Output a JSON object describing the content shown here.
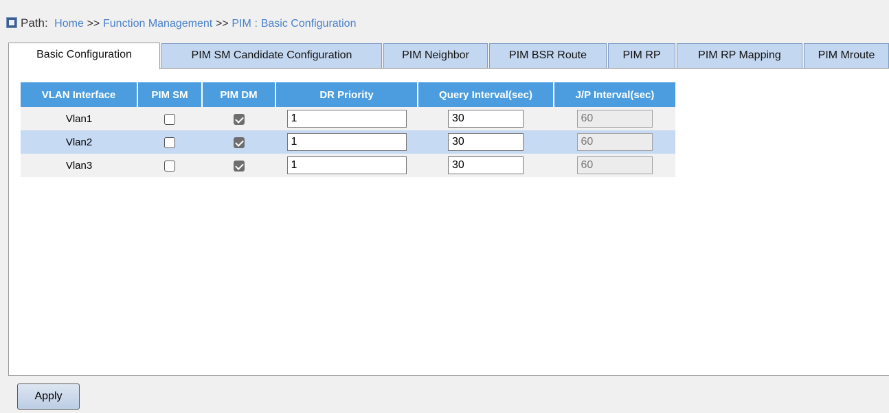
{
  "breadcrumb": {
    "label": "Path:",
    "home": "Home",
    "separator": ">>",
    "function_management": "Function Management",
    "pim": "PIM",
    "colon": ":",
    "current": "Basic Configuration"
  },
  "tabs": [
    {
      "label": "Basic Configuration",
      "active": true
    },
    {
      "label": "PIM SM Candidate Configuration",
      "active": false
    },
    {
      "label": "PIM Neighbor",
      "active": false
    },
    {
      "label": "PIM BSR Route",
      "active": false
    },
    {
      "label": "PIM RP",
      "active": false
    },
    {
      "label": "PIM RP Mapping",
      "active": false
    },
    {
      "label": "PIM Mroute",
      "active": false
    }
  ],
  "table": {
    "columns": [
      "VLAN Interface",
      "PIM SM",
      "PIM DM",
      "DR Priority",
      "Query Interval(sec)",
      "J/P Interval(sec)"
    ],
    "rows": [
      {
        "vlan": "Vlan1",
        "pim_sm": false,
        "pim_dm": true,
        "dr_priority": "1",
        "query_interval": "30",
        "jp_interval": "60"
      },
      {
        "vlan": "Vlan2",
        "pim_sm": false,
        "pim_dm": true,
        "dr_priority": "1",
        "query_interval": "30",
        "jp_interval": "60"
      },
      {
        "vlan": "Vlan3",
        "pim_sm": false,
        "pim_dm": true,
        "dr_priority": "1",
        "query_interval": "30",
        "jp_interval": "60"
      }
    ]
  },
  "buttons": {
    "apply": "Apply"
  },
  "colors": {
    "header_blue": "#4b9de0",
    "tab_blue": "#c4d7f0",
    "row_alt": "#c7daf3",
    "link_blue": "#4a80c8"
  }
}
